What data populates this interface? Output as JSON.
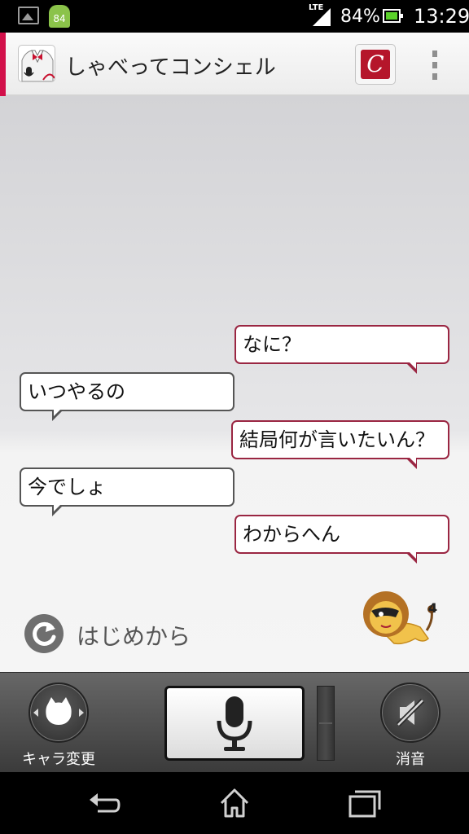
{
  "status_bar": {
    "notification_count": "84",
    "network": "LTE",
    "battery": "84%",
    "time": "13:29",
    "icons": [
      "gallery-icon",
      "android-icon",
      "signal-icon",
      "battery-icon"
    ]
  },
  "app_bar": {
    "title": "しゃべってコンシェル",
    "accent_color": "#d2104a",
    "c_button_letter": "C"
  },
  "conversation": [
    {
      "speaker": "concierge",
      "text": "なに？"
    },
    {
      "speaker": "user",
      "text": "いつやるの"
    },
    {
      "speaker": "concierge",
      "text": "結局何が言いたいん？"
    },
    {
      "speaker": "user",
      "text": "今でしょ"
    },
    {
      "speaker": "concierge",
      "text": "わからへん"
    }
  ],
  "restart": {
    "label": "はじめから"
  },
  "controls": {
    "character_label": "キャラ変更",
    "mute_label": "消音"
  },
  "colors": {
    "concierge_border": "#9a2642",
    "user_border": "#555555"
  }
}
